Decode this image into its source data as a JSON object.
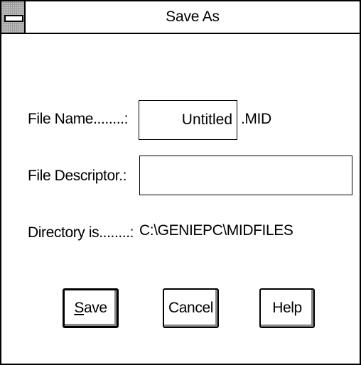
{
  "window": {
    "title": "Save As"
  },
  "form": {
    "file_name_label": "File Name........:",
    "file_name_value": "Untitled",
    "file_extension": ".MID",
    "file_descriptor_label": "File Descriptor.:",
    "file_descriptor_value": "",
    "directory_label": "Directory is........:",
    "directory_value": "C:\\GENIEPC\\MIDFILES"
  },
  "buttons": {
    "save_mnemonic": "S",
    "save_rest": "ave",
    "cancel_label": "Cancel",
    "help_label": "Help"
  },
  "icons": {
    "system_menu": "system-menu-icon"
  }
}
